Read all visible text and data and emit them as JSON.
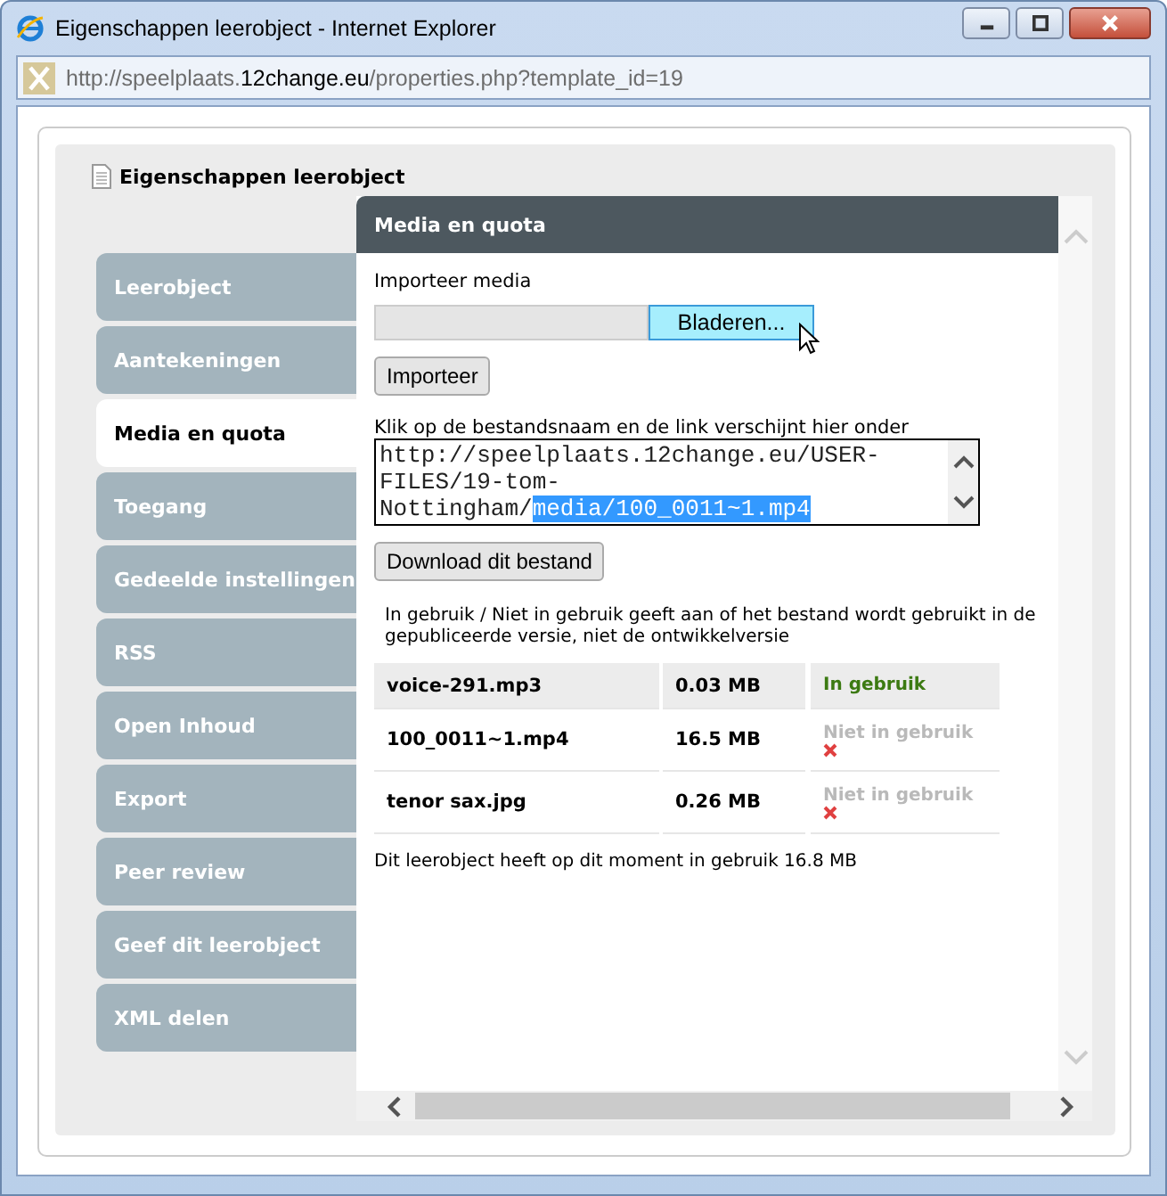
{
  "window": {
    "title": "Eigenschappen leerobject - Internet Explorer"
  },
  "address": [
    {
      "kind": "dim",
      "text": "http://speelplaats."
    },
    {
      "kind": "host",
      "text": "12change.eu"
    },
    {
      "kind": "dim",
      "text": "/properties.php?template_id=19"
    }
  ],
  "page_title": "Eigenschappen leerobject",
  "tabs": [
    {
      "label": "Leerobject",
      "selected": false
    },
    {
      "label": "Aantekeningen",
      "selected": false
    },
    {
      "label": "Media en quota",
      "selected": true
    },
    {
      "label": "Toegang",
      "selected": false
    },
    {
      "label": "Gedeelde instellingen",
      "selected": false
    },
    {
      "label": "RSS",
      "selected": false
    },
    {
      "label": "Open Inhoud",
      "selected": false
    },
    {
      "label": "Export",
      "selected": false
    },
    {
      "label": "Peer review",
      "selected": false
    },
    {
      "label": "Geef dit leerobject",
      "selected": false
    },
    {
      "label": "XML delen",
      "selected": false
    }
  ],
  "panel": {
    "title": "Media en quota",
    "import_label": "Importeer media",
    "browse_button": {
      "label": "Bladeren...",
      "hovered": true
    },
    "import_button": "Importeer",
    "link_label": "Klik op de bestandsnaam en de link verschijnt hier onder",
    "link_box": {
      "text": "http://speelplaats.12change.eu/USER-FILES/19-tom-Nottingham/",
      "selected_text": "media/100_0011~1.mp4"
    },
    "download_button": "Download dit bestand",
    "note": "In gebruik / Niet in gebruik geeft aan of het bestand wordt gebruikt in de gepubliceerde versie, niet de ontwikkelversie",
    "files": [
      {
        "name": "voice-291.mp3",
        "size": "0.03 MB",
        "status": "In gebruik",
        "in_use": true,
        "highlighted": true
      },
      {
        "name": "100_0011~1.mp4",
        "size": "16.5 MB",
        "status": "Niet in gebruik",
        "in_use": false,
        "highlighted": false
      },
      {
        "name": "tenor sax.jpg",
        "size": "0.26 MB",
        "status": "Niet in gebruik",
        "in_use": false,
        "highlighted": false
      }
    ],
    "total": "Dit leerobject heeft op dit moment in gebruik 16.8 MB"
  }
}
